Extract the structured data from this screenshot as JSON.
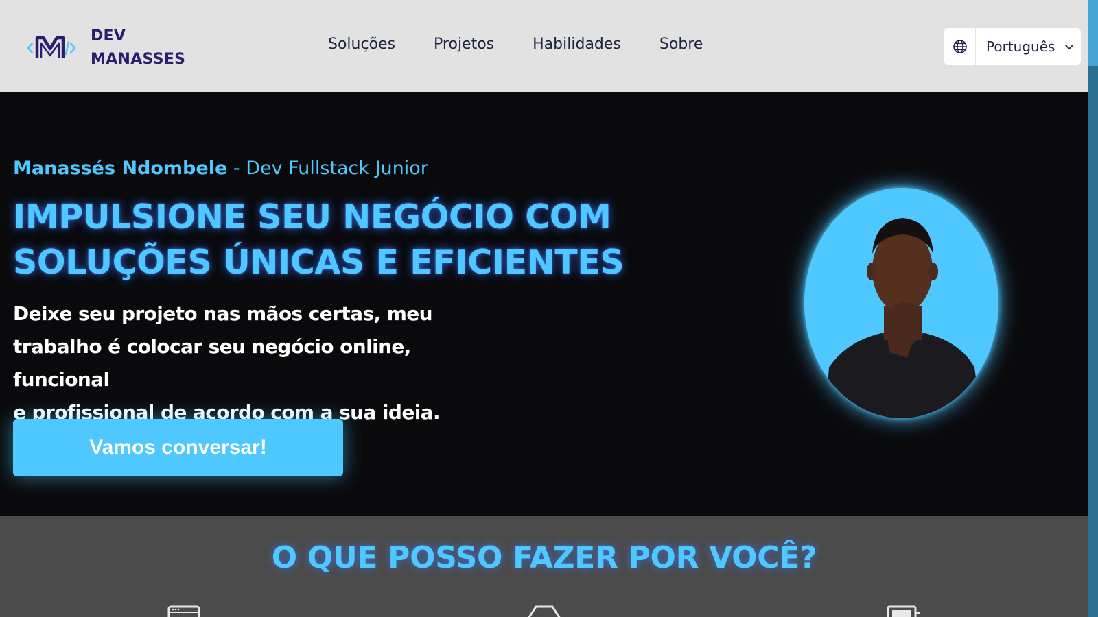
{
  "brand": {
    "line1": "DEV",
    "line2": "MANASSES"
  },
  "nav": [
    {
      "label": "Soluções"
    },
    {
      "label": "Projetos"
    },
    {
      "label": "Habilidades"
    },
    {
      "label": "Sobre"
    }
  ],
  "language": {
    "selected": "Português",
    "icon": "globe-icon"
  },
  "hero": {
    "name": "Manassés Ndombele",
    "separator": " - ",
    "role": "Dev Fullstack Junior",
    "title_line1": "IMPULSIONE SEU NEGÓCIO COM",
    "title_line2": "SOLUÇÕES ÚNICAS E EFICIENTES",
    "desc_line1": "Deixe seu projeto nas mãos certas, meu",
    "desc_line2": "trabalho é colocar seu negócio online, funcional",
    "desc_line3": "e profissional de acordo com a sua ideia.",
    "cta": "Vamos conversar!"
  },
  "services": {
    "title": "O QUE POSSO FAZER POR VOCÊ?",
    "icons": [
      "browser-window-icon",
      "hexagon-icon",
      "monitor-icon"
    ]
  },
  "colors": {
    "accent": "#4fc8ff",
    "header_bg": "#e2e2e2",
    "hero_bg": "#0a0a0d",
    "services_bg": "#4b4b4b",
    "brand_text": "#2a1f6e"
  }
}
